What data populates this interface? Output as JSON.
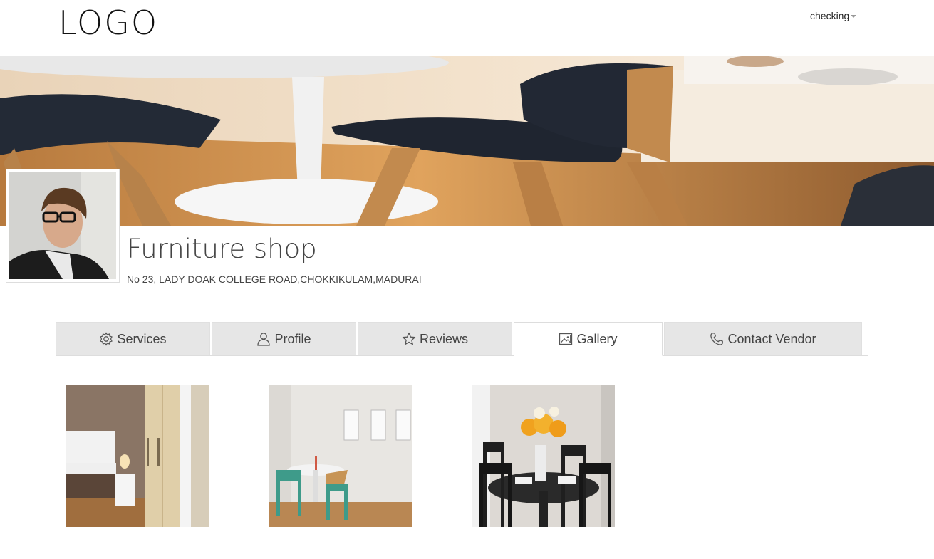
{
  "header": {
    "logo": "LOGO",
    "user_menu_label": "checking"
  },
  "shop": {
    "name": "Furniture shop",
    "address": "No 23, LADY DOAK COLLEGE ROAD,CHOKKIKULAM,MADURAI"
  },
  "tabs": [
    {
      "label": "Services",
      "icon": "gear-icon"
    },
    {
      "label": "Profile",
      "icon": "user-icon"
    },
    {
      "label": "Reviews",
      "icon": "star-icon"
    },
    {
      "label": "Gallery",
      "icon": "image-icon",
      "active": true
    },
    {
      "label": "Contact Vendor",
      "icon": "phone-icon"
    }
  ],
  "gallery": [
    {
      "subject": "bedroom-photo"
    },
    {
      "subject": "dining-nook-photo"
    },
    {
      "subject": "dining-table-flowers-photo"
    }
  ]
}
